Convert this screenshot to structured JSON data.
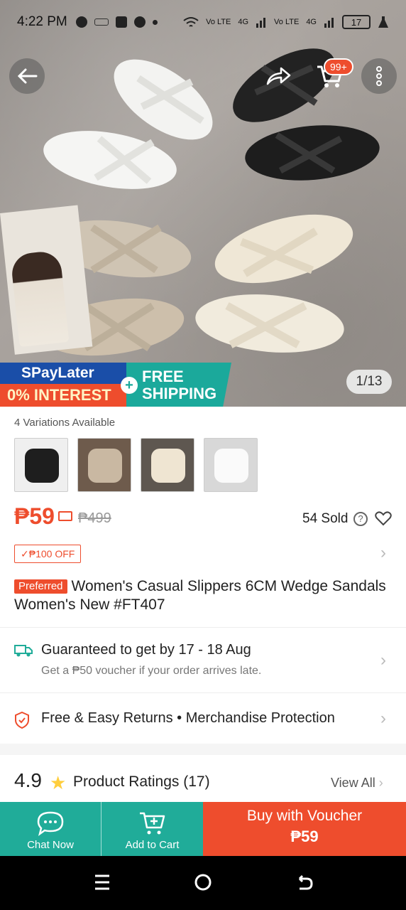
{
  "status_bar": {
    "time": "4:22 PM",
    "battery": "17",
    "network_labels": [
      "Vo LTE",
      "4G",
      "Vo LTE",
      "4G"
    ]
  },
  "hero": {
    "cart_badge": "99+",
    "image_counter": "1/13",
    "promo": {
      "spaylater": "SPayLater",
      "interest": "0% INTEREST",
      "free": "FREE",
      "shipping": "SHIPPING"
    }
  },
  "product": {
    "variations_label": "4 Variations Available",
    "price": "₱59",
    "original_price": "₱499",
    "sold": "54 Sold",
    "voucher_tag": "✓₱100 OFF",
    "preferred_badge": "Preferred",
    "title": "Women's Casual Slippers 6CM Wedge Sandals Women's New #FT407"
  },
  "delivery": {
    "guarantee": "Guaranteed to get by 17 - 18 Aug",
    "late_note": "Get a ₱50 voucher if your order arrives late."
  },
  "returns": {
    "text": "Free & Easy Returns  •  Merchandise Protection"
  },
  "ratings": {
    "score": "4.9",
    "label": "Product Ratings (17)",
    "view_all": "View All"
  },
  "actions": {
    "chat": "Chat Now",
    "add_cart": "Add to Cart",
    "buy_line1": "Buy with Voucher",
    "buy_line2": "₱59"
  },
  "colors": {
    "accent": "#ee4d2d",
    "teal": "#20ac99",
    "star": "#ffce3d"
  }
}
